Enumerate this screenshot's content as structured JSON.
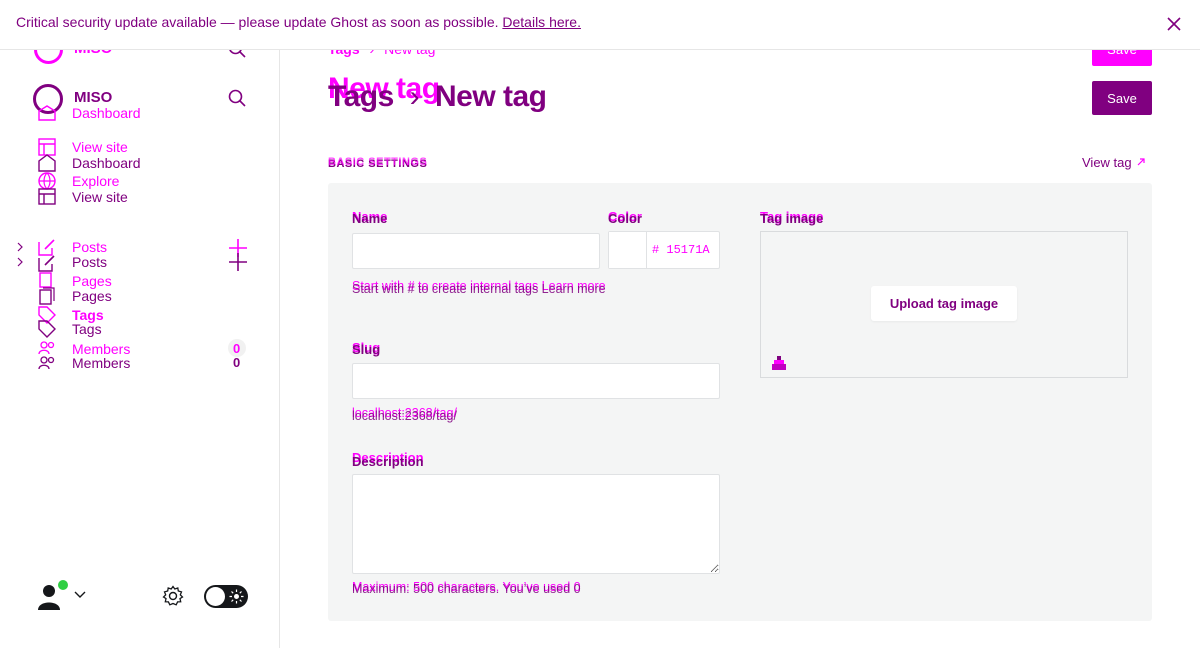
{
  "banner": {
    "message": "Critical security update available — please update Ghost as soon as possible.",
    "link_text": "Details here."
  },
  "site": {
    "name": "MISO"
  },
  "sidebar": {
    "items": [
      {
        "label": "Dashboard"
      },
      {
        "label": "View site"
      },
      {
        "label": "Explore"
      },
      {
        "label": "Posts"
      },
      {
        "label": "Pages"
      },
      {
        "label": "Tags"
      },
      {
        "label": "Members",
        "count": "0"
      }
    ]
  },
  "header": {
    "breadcrumb_parent": "Tags",
    "breadcrumb_current": "New tag",
    "title_parent": "Tags",
    "title_current": "New tag",
    "save_label": "Save"
  },
  "settings": {
    "section_label": "BASIC SETTINGS",
    "view_tag_label": "View tag",
    "name_label": "Name",
    "name_value": "",
    "name_hint": "Start with # to create internal tags Learn more",
    "color_label": "Color",
    "color_value": "15171A",
    "color_prefix": "#",
    "slug_label": "Slug",
    "slug_value": "",
    "slug_hint": "localhost:2368/tag/",
    "description_label": "Description",
    "description_value": "",
    "description_hint": "Maximum: 500 characters. You’ve used 0",
    "image_label": "Tag image",
    "upload_label": "Upload tag image"
  },
  "colors": {
    "accent_magenta": "#ff00ff",
    "accent_purple": "#800080",
    "online_dot": "#30cf43",
    "panel_bg": "#f4f5f5"
  },
  "icons": [
    "close-icon",
    "search-icon",
    "home-icon",
    "site-icon",
    "globe-icon",
    "edit-icon",
    "page-icon",
    "tag-icon",
    "members-icon",
    "plus-icon",
    "chevron-right-icon",
    "gear-icon",
    "avatar",
    "external-link-icon",
    "upload-icon"
  ]
}
